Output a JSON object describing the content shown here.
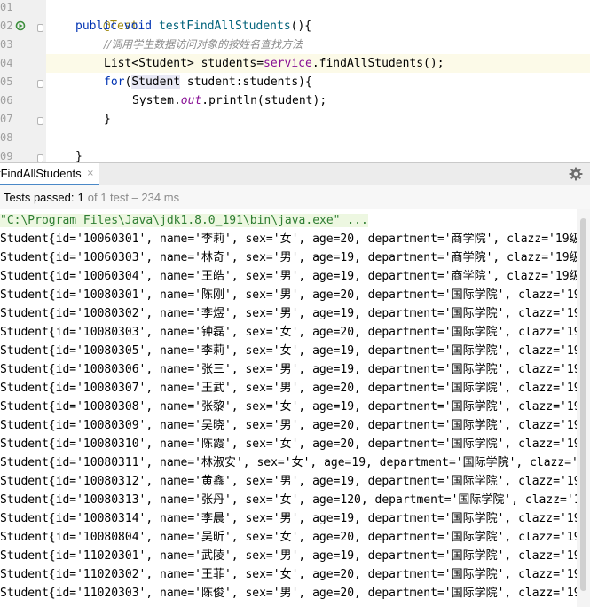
{
  "editor": {
    "line_numbers": [
      "01",
      "02",
      "03",
      "04",
      "05",
      "06",
      "07",
      "08",
      "09"
    ],
    "annotation": "@Test",
    "method_sig": {
      "kw_public": "public",
      "kw_void": "void",
      "name": "testFindAllStudents",
      "tail": "(){"
    },
    "comment": "//调用学生数据访问对象的按姓名查找方法",
    "list_line": {
      "pre": "List<",
      "cls": "Student",
      "mid": "> students=",
      "field": "service",
      "post": ".findAllStudents();"
    },
    "for_line": {
      "kw": "for",
      "open": "(",
      "cls": "Student",
      "rest": " student:students){"
    },
    "print_line": {
      "pre": "System.",
      "field": "out",
      "post": ".println(student);"
    },
    "close_inner": "}",
    "close_outer": "}"
  },
  "run": {
    "tab_label": "tFindAllStudents",
    "tab_close": "×",
    "status_label": "Tests passed:",
    "status_count": "1",
    "status_rest": "of 1 test – 234 ms"
  },
  "console": {
    "command": "\"C:\\Program Files\\Java\\jdk1.8.0_191\\bin\\java.exe\" ...",
    "lines": [
      "Student{id='10060301', name='李莉', sex='女', age=20, department='商学院', clazz='19级",
      "Student{id='10060303', name='林奇', sex='男', age=19, department='商学院', clazz='19级",
      "Student{id='10060304', name='王皓', sex='男', age=19, department='商学院', clazz='19级",
      "Student{id='10080301', name='陈刚', sex='男', age=20, department='国际学院', clazz='19",
      "Student{id='10080302', name='李煜', sex='男', age=19, department='国际学院', clazz='19",
      "Student{id='10080303', name='钟磊', sex='女', age=20, department='国际学院', clazz='19",
      "Student{id='10080305', name='李莉', sex='女', age=19, department='国际学院', clazz='19",
      "Student{id='10080306', name='张三', sex='男', age=19, department='国际学院', clazz='19",
      "Student{id='10080307', name='王武', sex='男', age=20, department='国际学院', clazz='19",
      "Student{id='10080308', name='张黎', sex='女', age=19, department='国际学院', clazz='19",
      "Student{id='10080309', name='吴晓', sex='男', age=20, department='国际学院', clazz='19",
      "Student{id='10080310', name='陈霞', sex='女', age=20, department='国际学院', clazz='19",
      "Student{id='10080311', name='林淑安', sex='女', age=19, department='国际学院', clazz='",
      "Student{id='10080312', name='黄鑫', sex='男', age=19, department='国际学院', clazz='19",
      "Student{id='10080313', name='张丹', sex='女', age=120, department='国际学院', clazz='1",
      "Student{id='10080314', name='李晨', sex='男', age=19, department='国际学院', clazz='19",
      "Student{id='10080804', name='吴昕', sex='女', age=20, department='国际学院', clazz='19",
      "Student{id='11020301', name='武陵', sex='男', age=19, department='国际学院', clazz='19",
      "Student{id='11020302', name='王菲', sex='女', age=20, department='国际学院', clazz='19",
      "Student{id='11020303', name='陈俊', sex='男', age=20, department='国际学院', clazz='19"
    ]
  }
}
